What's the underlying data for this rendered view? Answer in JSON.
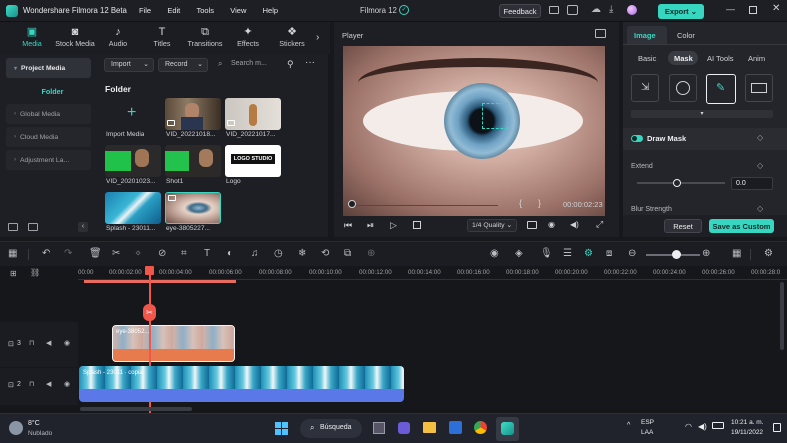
{
  "app": {
    "title": "Wondershare Filmora 12 Beta",
    "center_title": "Filmora 12",
    "menu": [
      "File",
      "Edit",
      "Tools",
      "View",
      "Help"
    ],
    "feedback_label": "Feedback",
    "export_label": "Export",
    "accent": "#37d6c0"
  },
  "media_tabs": [
    {
      "label": "Media",
      "icon": "media-icon",
      "active": true
    },
    {
      "label": "Stock Media",
      "icon": "stock-media-icon"
    },
    {
      "label": "Audio",
      "icon": "music-note-icon"
    },
    {
      "label": "Titles",
      "icon": "titles-icon"
    },
    {
      "label": "Transitions",
      "icon": "transitions-icon"
    },
    {
      "label": "Effects",
      "icon": "effects-icon"
    },
    {
      "label": "Stickers",
      "icon": "stickers-icon"
    }
  ],
  "media_nav": {
    "project_media": "Project Media",
    "folder": "Folder",
    "global_media": "Global Media",
    "cloud_media": "Cloud Media",
    "adjustment_layer": "Adjustment La..."
  },
  "media_toolbar": {
    "import": "Import",
    "record": "Record",
    "search_placeholder": "Search m..."
  },
  "media_grid": {
    "folder_title": "Folder",
    "import_label": "Import Media",
    "items": [
      {
        "label": "VID_20221018..."
      },
      {
        "label": "VID_20221017..."
      },
      {
        "label": "VID_20201023..."
      },
      {
        "label": "Shot1"
      },
      {
        "label": "Logo",
        "logo_text": "LOGO STUDIO"
      },
      {
        "label": "Splash - 23011..."
      },
      {
        "label": "eye-3805227..."
      }
    ]
  },
  "player": {
    "title": "Player",
    "timecode": "00:00:02:23",
    "quality": "1/4 Quality",
    "progress": 0.02
  },
  "properties": {
    "tabs": [
      "Image",
      "Color"
    ],
    "subtabs": [
      "Basic",
      "Mask",
      "AI Tools",
      "Anim"
    ],
    "section_title": "Draw Mask",
    "extend_label": "Extend",
    "extend_value": "0.0",
    "blur_label": "Blur Strength",
    "reset_label": "Reset",
    "save_label": "Save as Custom"
  },
  "timeline": {
    "ticks": [
      "00:00",
      "00:00:02:00",
      "00:00:04:00",
      "00:00:06:00",
      "00:00:08:00",
      "00:00:10:00",
      "00:00:12:00",
      "00:00:14:00",
      "00:00:16:00",
      "00:00:18:00",
      "00:00:20:00",
      "00:00:22:00",
      "00:00:24:00",
      "00:00:26:00",
      "00:00:28:0"
    ],
    "track3_label": "3",
    "track2_label": "2",
    "clip_eye_label": "eye-38052...",
    "clip_splash_label": "Splash - 23011 · copia"
  },
  "taskbar": {
    "weather_temp": "8°C",
    "weather_desc": "Nublado",
    "search_label": "Búsqueda",
    "lang_1": "ESP",
    "lang_2": "LAA",
    "time": "10:21 a. m.",
    "date": "19/11/2022"
  }
}
